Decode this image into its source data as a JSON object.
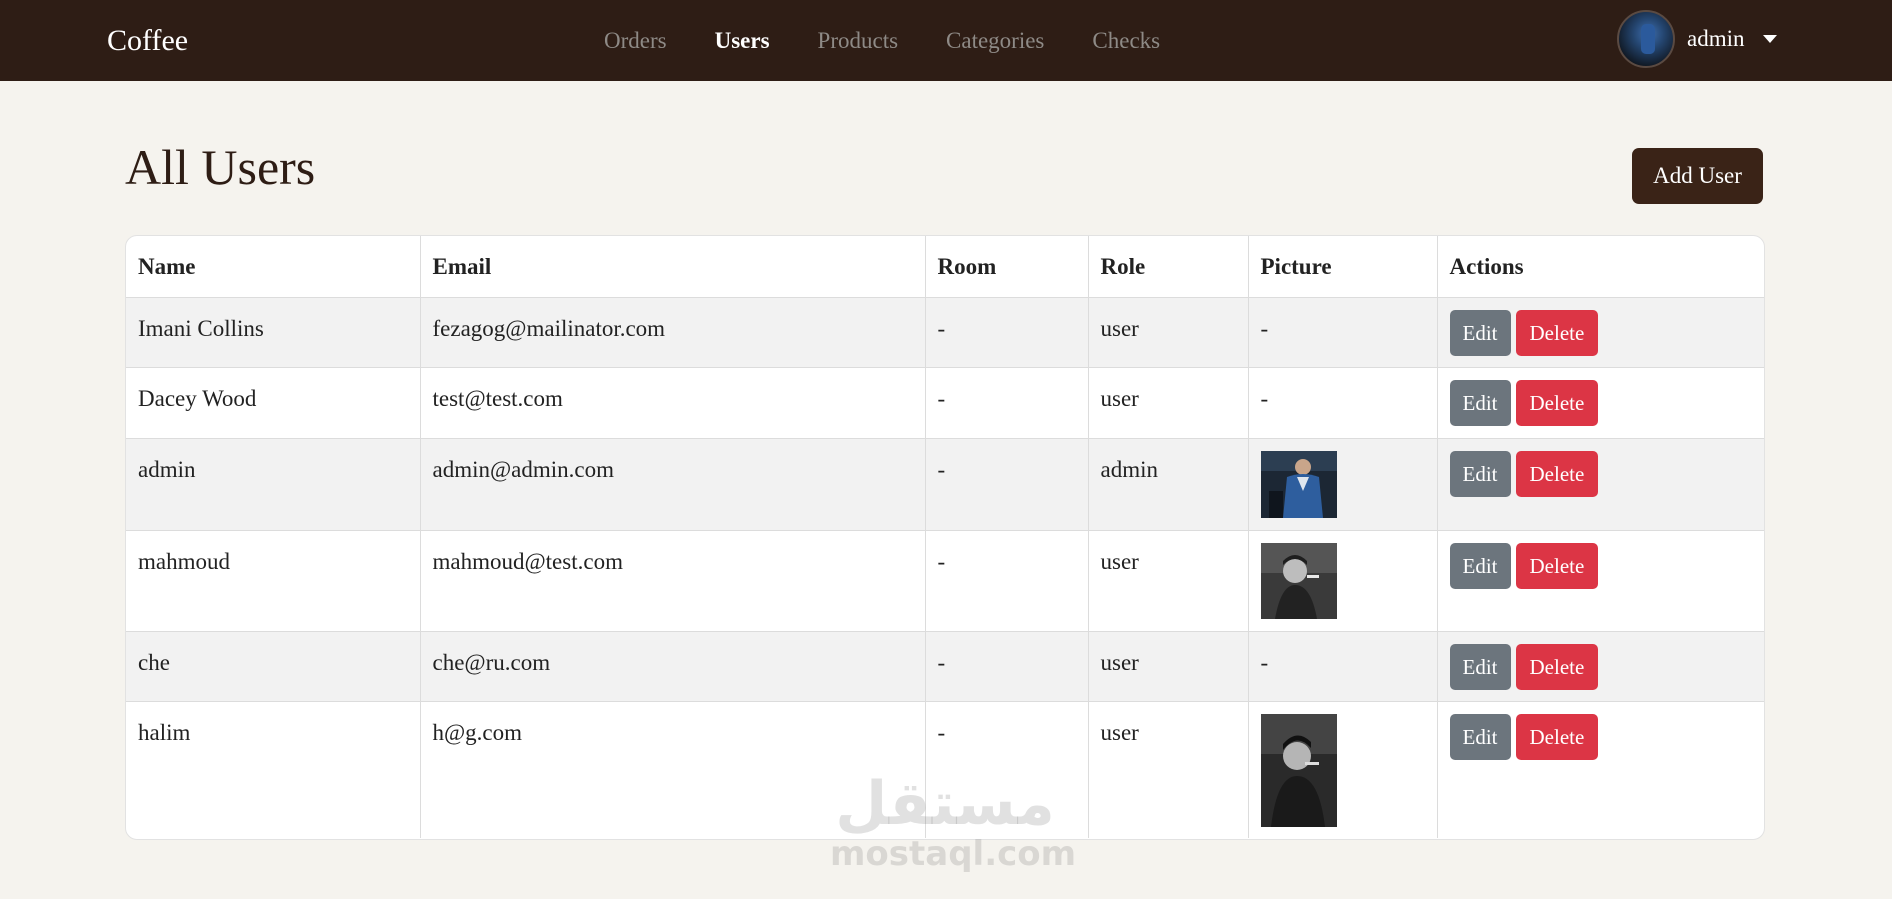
{
  "navbar": {
    "brand": "Coffee",
    "links": [
      {
        "label": "Orders",
        "active": false
      },
      {
        "label": "Users",
        "active": true
      },
      {
        "label": "Products",
        "active": false
      },
      {
        "label": "Categories",
        "active": false
      },
      {
        "label": "Checks",
        "active": false
      }
    ],
    "user": {
      "name": "admin"
    }
  },
  "page": {
    "title": "All Users",
    "add_button": "Add User"
  },
  "table": {
    "headers": [
      "Name",
      "Email",
      "Room",
      "Role",
      "Picture",
      "Actions"
    ],
    "edit_label": "Edit",
    "delete_label": "Delete",
    "rows": [
      {
        "name": "Imani Collins",
        "email": "fezagog@mailinator.com",
        "room": "-",
        "role": "user",
        "picture": "-"
      },
      {
        "name": "Dacey Wood",
        "email": "test@test.com",
        "room": "-",
        "role": "user",
        "picture": "-"
      },
      {
        "name": "admin",
        "email": "admin@admin.com",
        "room": "-",
        "role": "admin",
        "picture": "photo-man-blue-suit"
      },
      {
        "name": "mahmoud",
        "email": "mahmoud@test.com",
        "room": "-",
        "role": "user",
        "picture": "photo-man-smoking-bw"
      },
      {
        "name": "che",
        "email": "che@ru.com",
        "room": "-",
        "role": "user",
        "picture": "-"
      },
      {
        "name": "halim",
        "email": "h@g.com",
        "room": "-",
        "role": "user",
        "picture": "photo-man-cigar-bw"
      }
    ]
  },
  "watermark": {
    "arabic": "مستقل",
    "latin": "mostaql.com"
  }
}
